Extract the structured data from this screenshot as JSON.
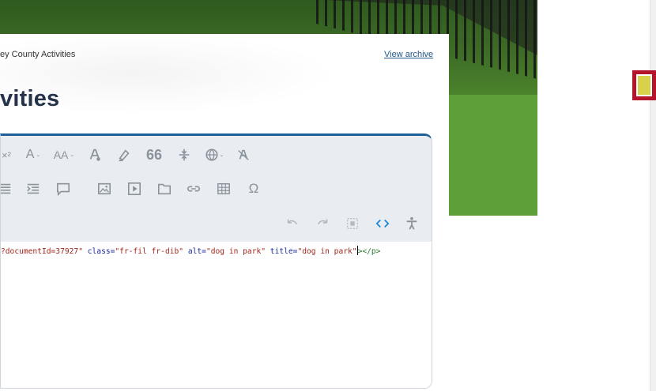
{
  "page": {
    "breadcrumb": "ey County Activities",
    "archive_link": "View archive",
    "title": "vities"
  },
  "editor": {
    "toolbar_row1": [
      "superscript-icon",
      "font-family-icon",
      "font-size-icon",
      "text-color-icon",
      "highlight-icon",
      "quote-icon",
      "line-height-icon",
      "language-icon",
      "clear-format-icon"
    ],
    "toolbar_row2": [
      "align-justify-icon",
      "indent-icon",
      "comment-icon",
      "insert-image-icon",
      "insert-video-icon",
      "insert-file-icon",
      "insert-link-icon",
      "insert-table-icon",
      "special-characters-icon"
    ],
    "toolbar_row3": [
      "undo-icon",
      "redo-icon",
      "select-all-icon",
      "code-view-icon",
      "accessibility-icon"
    ],
    "glyphs": {
      "superscript": "×²",
      "font_family": "A",
      "font_size": "AA",
      "quote": "66",
      "special_chars": "Ω"
    },
    "code": {
      "part1": "?documentId=37927\"",
      "attr1": " class=",
      "val1": "\"fr-fil fr-dib\"",
      "attr2": " alt=",
      "val2": "\"dog in park\"",
      "attr3": " title=",
      "val3": "\"dog in park\"",
      "tag_end": "></p>"
    }
  },
  "colors": {
    "accent": "#1f5f98",
    "active_icon": "#1a8ad6",
    "badge": "#b5152b"
  }
}
